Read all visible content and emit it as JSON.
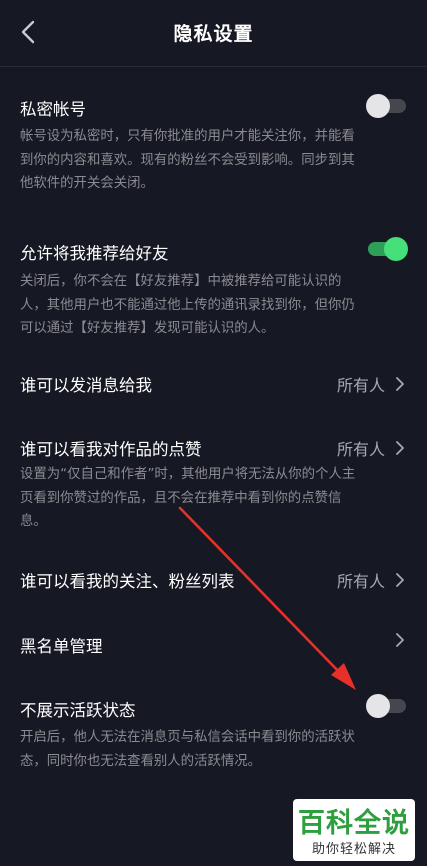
{
  "header": {
    "title": "隐私设置"
  },
  "settings": {
    "private_account": {
      "title": "私密帐号",
      "toggle": "off",
      "desc": [
        "帐号设为私密时，只有你批准的用户才能关注你，并能看",
        "到你的内容和喜欢。现有的粉丝不会受到影响。同步到其",
        "他软件的开关会关闭。"
      ]
    },
    "recommend_friends": {
      "title": "允许将我推荐给好友",
      "toggle": "on",
      "desc": [
        "关闭后，你不会在【好友推荐】中被推荐给可能认识的",
        "人，其他用户也不能通过他上传的通讯录找到你，但你仍",
        "可以通过【好友推荐】发现可能认识的人。"
      ]
    },
    "who_can_message": {
      "title": "谁可以发消息给我",
      "value": "所有人"
    },
    "who_can_see_likes": {
      "title": "谁可以看我对作品的点赞",
      "value": "所有人",
      "desc": [
        "设置为“仅自己和作者”时，其他用户将无法从你的个人主",
        "页看到你赞过的作品，且不会在推荐中看到你的点赞信",
        "息。"
      ]
    },
    "who_can_see_follows": {
      "title": "谁可以看我的关注、粉丝列表",
      "value": "所有人"
    },
    "blacklist": {
      "title": "黑名单管理"
    },
    "hide_activity": {
      "title": "不展示活跃状态",
      "toggle": "off",
      "desc": [
        "开启后，他人无法在消息页与私信会话中看到你的活跃状",
        "态，同时你也无法查看别人的活跃情况。"
      ]
    }
  },
  "watermark": {
    "main": "百科全说",
    "sub": "助你轻松解决"
  },
  "colors": {
    "background": "#161823",
    "toggle_on": "#46e07b",
    "annotation_arrow": "#e8302a",
    "watermark_green": "#2f9e3f"
  }
}
